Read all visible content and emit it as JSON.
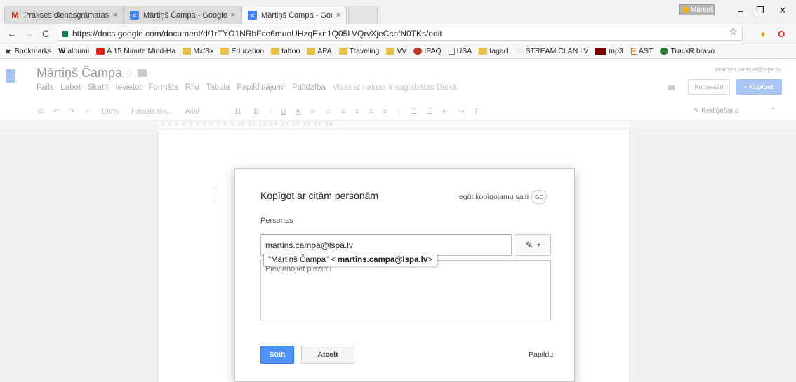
{
  "browser": {
    "tabs": [
      {
        "title": "Prakses dienasgrāmatas",
        "icon": "gmail-icon"
      },
      {
        "title": "Mārtiņš Čampa - Google",
        "icon": "docs-icon"
      },
      {
        "title": "Mārtiņš Čampa - Google",
        "icon": "docs-icon"
      }
    ],
    "tab_close": "×",
    "profile_name": "Mārtiņš",
    "url": "https://docs.google.com/document/d/1rTYO1NRbFce6muoUHzqExn1Q05LVQrvXjeCcofN0TKs/edit",
    "bookmarks": [
      {
        "label": "Bookmarks",
        "icon": "star-icon"
      },
      {
        "label": "albumi",
        "icon": "w-icon"
      },
      {
        "label": "A 15 Minute Mind-Ha",
        "icon": "youtube-icon"
      },
      {
        "label": "Mx/Sx",
        "icon": "folder-icon"
      },
      {
        "label": "Education",
        "icon": "folder-icon"
      },
      {
        "label": "tattoo",
        "icon": "folder-icon"
      },
      {
        "label": "APA",
        "icon": "folder-icon"
      },
      {
        "label": "Traveling",
        "icon": "folder-icon"
      },
      {
        "label": "VV",
        "icon": "folder-icon"
      },
      {
        "label": "IPAQ",
        "icon": "bear-icon"
      },
      {
        "label": "USA",
        "icon": "page-icon"
      },
      {
        "label": "tagad",
        "icon": "folder-icon"
      },
      {
        "label": "STREAM.CLAN.LV",
        "icon": "blank-icon"
      },
      {
        "label": "mp3",
        "icon": "music-icon"
      },
      {
        "label": "AST",
        "icon": "e-icon"
      },
      {
        "label": "TrackR bravo",
        "icon": "trackr-icon"
      }
    ]
  },
  "docs": {
    "title": "Mārtiņš Čampa",
    "menu": [
      "Fails",
      "Labot",
      "Skatīt",
      "Ievietot",
      "Formāts",
      "Rīki",
      "Tabula",
      "Papildinājumi",
      "Palīdzība"
    ],
    "saved_note": "Visas izmaiņas ir saglabātas Diskā.",
    "account_email": "martins.campa@lspa.lv",
    "comments_label": "Komentāri",
    "share_label": "Kopīgot",
    "toolbar": {
      "zoom": "100%",
      "style": "Parasts tek...",
      "font": "Arial",
      "size": "11",
      "editing_mode": "Rediģēšana"
    },
    "ruler_marks": "2 1 1 2 3 4 5 6 7 8 9 10 11 12 13 14 15 16 17 18"
  },
  "share_dialog": {
    "title": "Kopīgot ar citām personām",
    "link_label": "Iegūt kopīgojamu saiti",
    "link_icon": "GD",
    "people_label": "Personas",
    "people_value": "martins.campa@lspa.lv",
    "suggestion_name": "\"Mārtiņš Čampa\" <",
    "suggestion_email": "martins.campa@lspa.lv",
    "suggestion_suffix": ">",
    "note_placeholder": "Pievienojiet piezīmi",
    "send_label": "Sūtīt",
    "cancel_label": "Atcelt",
    "more_label": "Papildu"
  }
}
